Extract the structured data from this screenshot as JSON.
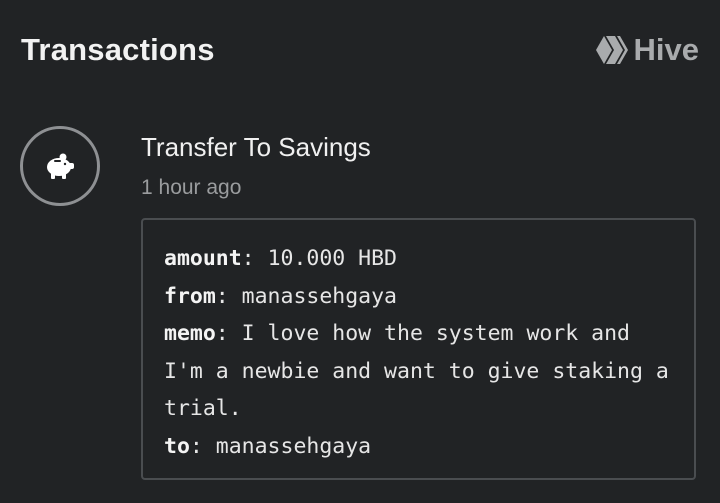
{
  "header": {
    "title": "Transactions",
    "brand_icon": "hive-logo-icon",
    "brand_name": "Hive"
  },
  "transaction": {
    "icon": "piggy-bank-icon",
    "type": "Transfer To Savings",
    "time": "1 hour ago",
    "details": [
      {
        "key": "amount",
        "sep": ": ",
        "value": "10.000 HBD"
      },
      {
        "key": "from",
        "sep": ": ",
        "value": "manassehgaya"
      },
      {
        "key": "memo",
        "sep": ": ",
        "value": "I love how the system work and I'm a newbie and want to give staking a trial."
      },
      {
        "key": "to",
        "sep": ": ",
        "value": "manassehgaya"
      }
    ]
  },
  "colors": {
    "background": "#212325",
    "text": "#f0f0f0",
    "muted": "#9a9c9e",
    "border": "#4a4d50"
  }
}
